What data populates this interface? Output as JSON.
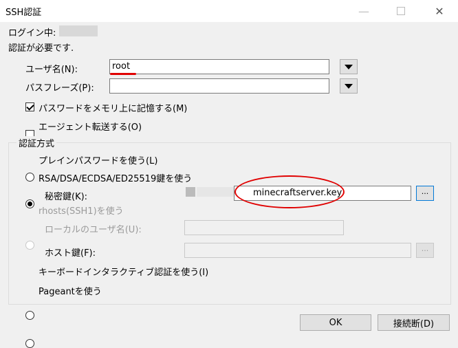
{
  "window": {
    "title": "SSH認証"
  },
  "status": {
    "login_label": "ログイン中:",
    "auth_required": "認証が必要です."
  },
  "fields": {
    "username_label": "ユーザ名(N):",
    "username_value": "root",
    "passphrase_label": "パスフレーズ(P):",
    "passphrase_value": ""
  },
  "options": {
    "remember_password": "パスワードをメモリ上に記憶する(M)",
    "remember_password_checked": true,
    "agent_forwarding": "エージェント転送する(O)",
    "agent_forwarding_checked": false
  },
  "auth": {
    "group_label": "認証方式",
    "plain_password": "プレインパスワードを使う(L)",
    "rsa_key": "RSA/DSA/ECDSA/ED25519鍵を使う",
    "private_key_label": "秘密鍵(K):",
    "private_key_value": "minecraftserver.key",
    "browse_label": "...",
    "rhosts": "rhosts(SSH1)を使う",
    "local_user_label": "ローカルのユーザ名(U):",
    "host_key_label": "ホスト鍵(F):",
    "keyboard_interactive": "キーボードインタラクティブ認証を使う(I)",
    "pageant": "Pageantを使う",
    "selected": "rsa_key"
  },
  "buttons": {
    "ok": "OK",
    "disconnect": "接続断(D)"
  },
  "icons": {
    "minimize": "minimize-icon",
    "maximize": "maximize-icon",
    "close": "close-icon",
    "dropdown": "chevron-down-icon"
  },
  "colors": {
    "annotation": "#e00000",
    "accent_border": "#0078d7"
  }
}
